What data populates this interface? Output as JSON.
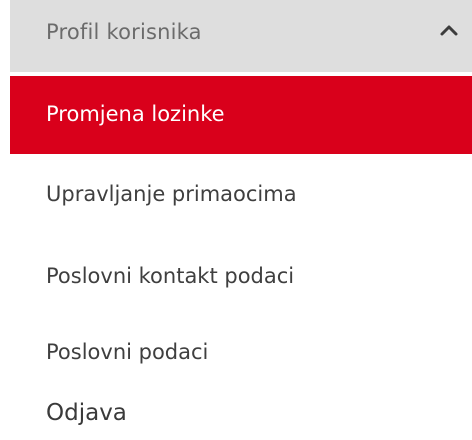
{
  "menu": {
    "header": {
      "label": "Profil korisnika",
      "icon": "chevron-up-icon",
      "background": "#dedede",
      "expanded": true
    },
    "active_color": "#d9001b",
    "items": [
      {
        "label": "Promjena lozinke",
        "active": true
      },
      {
        "label": "Upravljanje primaocima",
        "active": false
      },
      {
        "label": "Poslovni kontakt podaci",
        "active": false
      },
      {
        "label": "Poslovni podaci",
        "active": false
      },
      {
        "label": "Odjava",
        "active": false
      }
    ]
  }
}
